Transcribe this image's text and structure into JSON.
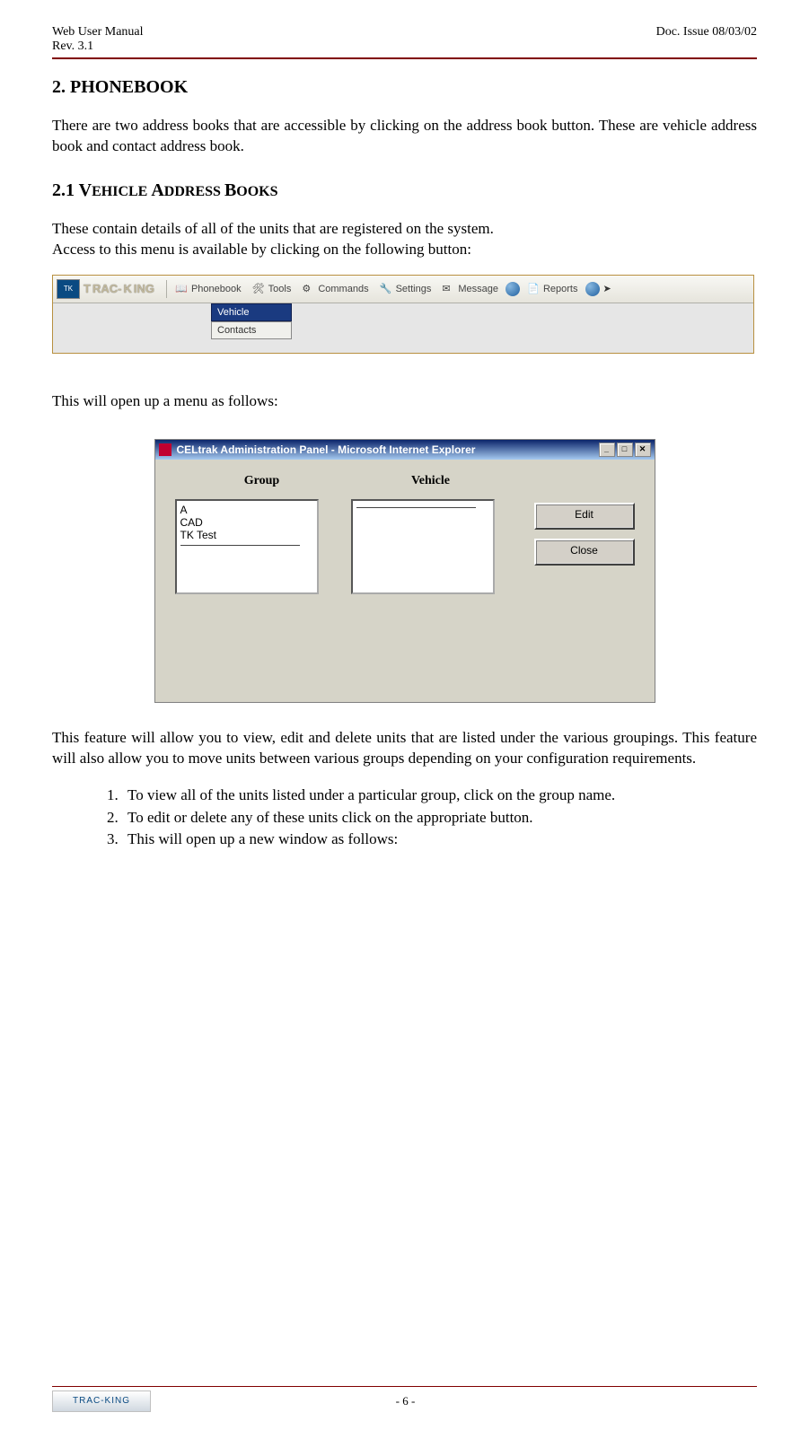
{
  "header": {
    "left_line1": "Web User Manual",
    "left_line2": "Rev. 3.1",
    "right_line1": "Doc. Issue 08/03/02"
  },
  "section": {
    "h2_number": "2. ",
    "h2_title": "Phonebook",
    "intro": "There are two address books that are accessible by clicking on the address book button.  These are vehicle address book and contact address book.",
    "h3_number": "2.1 ",
    "h3_title": "Vehicle Address Books",
    "p1": "These contain details of all of the units that are registered on the system.",
    "p2": "Access to this menu is available by clicking on the following button:",
    "p3": "This will open up a menu as follows:",
    "p4": "This feature will allow you to view, edit and delete units that are listed under the various groupings. This feature will also allow you to move units between various groups depending on your configuration requirements.",
    "list": [
      "To view all of the units listed under a particular group, click on the group name.",
      "To edit or delete any of these units click on the appropriate button.",
      "This will open up a new window as follows:"
    ]
  },
  "toolbar": {
    "brand": "Trac-King",
    "items": [
      "Phonebook",
      "Tools",
      "Commands",
      "Settings",
      "Message",
      "Reports"
    ],
    "dropdown": [
      "Vehicle",
      "Contacts"
    ]
  },
  "admin": {
    "title": "CELtrak Administration Panel - Microsoft Internet Explorer",
    "group_header": "Group",
    "vehicle_header": "Vehicle",
    "groups": [
      "A",
      "CAD",
      "TK Test"
    ],
    "edit_btn": "Edit",
    "close_btn": "Close"
  },
  "footer": {
    "logo_text": "TRAC-KING",
    "page": "- 6 -"
  }
}
